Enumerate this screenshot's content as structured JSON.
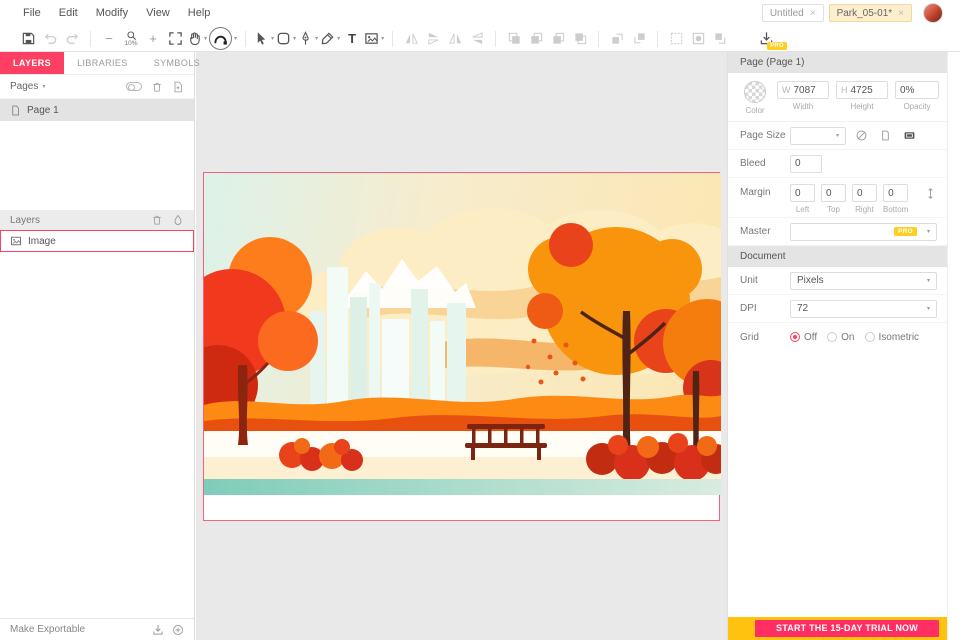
{
  "app": {
    "menus": [
      "File",
      "Edit",
      "Modify",
      "View",
      "Help"
    ],
    "tabs": [
      {
        "label": "Untitled"
      },
      {
        "label": "Park_05-01*"
      }
    ],
    "zoom": "10%",
    "pro_badge": "PRO"
  },
  "left_panel": {
    "tabs": [
      "LAYERS",
      "LIBRARIES",
      "SYMBOLS"
    ],
    "pages_label": "Pages",
    "page_item": "Page 1",
    "layers_label": "Layers",
    "layer_item": "Image",
    "make_exportable": "Make Exportable"
  },
  "right_panel": {
    "header": "Page (Page 1)",
    "color_label": "Color",
    "width": {
      "prefix": "W",
      "value": "7087",
      "label": "Width"
    },
    "height": {
      "prefix": "H",
      "value": "4725",
      "label": "Height"
    },
    "opacity": {
      "value": "0%",
      "label": "Opacity"
    },
    "page_size_label": "Page Size",
    "bleed_label": "Bleed",
    "bleed_value": "0",
    "margin_label": "Margin",
    "margins": [
      {
        "value": "0",
        "label": "Left"
      },
      {
        "value": "0",
        "label": "Top"
      },
      {
        "value": "0",
        "label": "Right"
      },
      {
        "value": "0",
        "label": "Bottom"
      }
    ],
    "master_label": "Master",
    "master_badge": "PRO",
    "document_header": "Document",
    "unit_label": "Unit",
    "unit_value": "Pixels",
    "dpi_label": "DPI",
    "dpi_value": "72",
    "grid_label": "Grid",
    "grid_options": [
      "Off",
      "On",
      "Isometric"
    ],
    "grid_selected": "Off",
    "trial_button": "START THE 15-DAY TRIAL NOW"
  },
  "colors": {
    "accent": "#fc3f62",
    "artboard_border": "#f4627f",
    "trial_strip": "#ffc20e",
    "trial_button_bg": "#ff2e63",
    "pro_badge_bg": "#ffce1f",
    "active_tab_bg": "#fdeecd"
  },
  "illustration_palette": {
    "sky_left": "#dcf2ea",
    "sky_right": "#fbe7b4",
    "cream": "#fcedc4",
    "wave_light": "#f8d393",
    "wave_deep": "#f5b669",
    "tree_orange": "#f8950d",
    "tree_red": "#f13a1d",
    "hill_orange": "#fd8a12",
    "hill_red": "#e8500f",
    "trunk_dark": "#4f2415",
    "bench": "#7c2414",
    "water": "#fffdf6",
    "ground_teal": "#7fccba"
  }
}
